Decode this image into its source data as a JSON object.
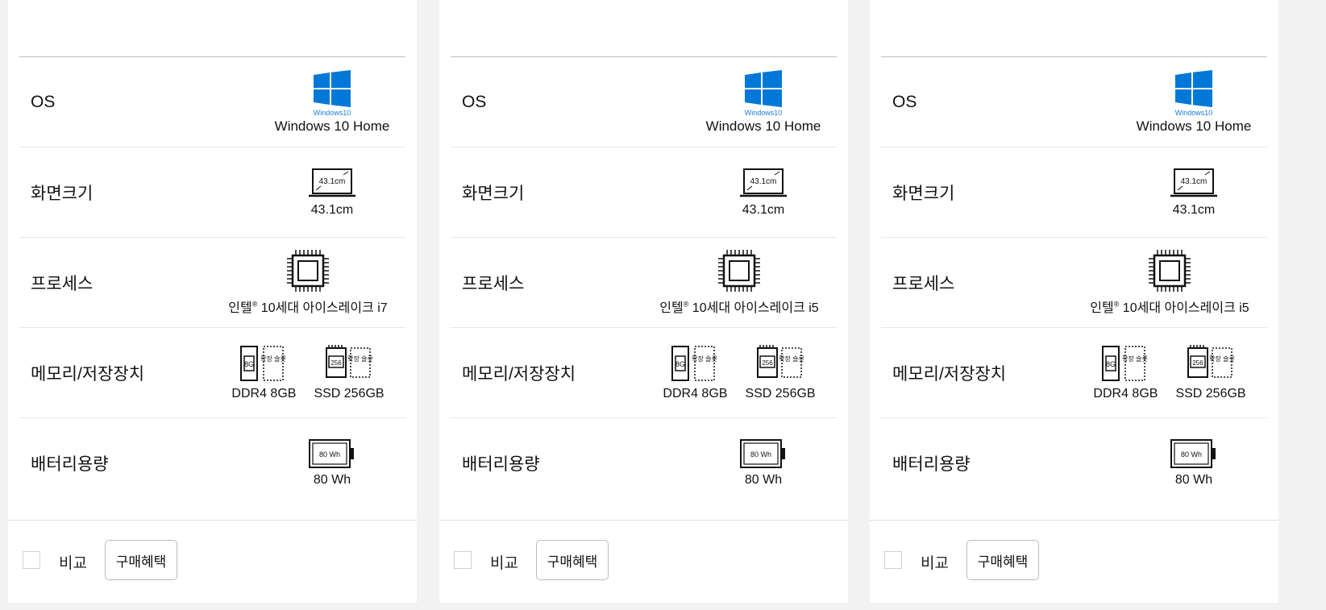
{
  "labels": {
    "os": "OS",
    "screen": "화면크기",
    "processor": "프로세스",
    "memory": "메모리/저장장치",
    "battery": "배터리용량"
  },
  "footer": {
    "compare_label": "비교",
    "benefit_button": "구매혜택"
  },
  "windows_logo_text": "Windows10",
  "brand_color": "#0078d7",
  "icons": [
    "windows-logo-icon",
    "laptop-screen-icon",
    "cpu-chip-icon",
    "ram-sd-card-icon",
    "ssd-card-icon",
    "battery-icon"
  ],
  "screen_icon_text": "43.1cm",
  "ram_icon_text": "8G",
  "ssd_icon_text": "256",
  "slot_icon_text": "확장 슬롯",
  "battery_icon_text": "80 Wh",
  "products": [
    {
      "os": "Windows 10 Home",
      "screen": "43.1cm",
      "processor_prefix": "인텔",
      "processor_reg": "®",
      "processor_rest": " 10세대 아이스레이크 i7",
      "memory": "DDR4 8GB",
      "storage": "SSD 256GB",
      "battery": "80 Wh"
    },
    {
      "os": "Windows 10 Home",
      "screen": "43.1cm",
      "processor_prefix": "인텔",
      "processor_reg": "®",
      "processor_rest": " 10세대 아이스레이크 i5",
      "memory": "DDR4 8GB",
      "storage": "SSD 256GB",
      "battery": "80 Wh"
    },
    {
      "os": "Windows 10 Home",
      "screen": "43.1cm",
      "processor_prefix": "인텔",
      "processor_reg": "®",
      "processor_rest": " 10세대 아이스레이크 i5",
      "memory": "DDR4 8GB",
      "storage": "SSD 256GB",
      "battery": "80 Wh"
    }
  ]
}
